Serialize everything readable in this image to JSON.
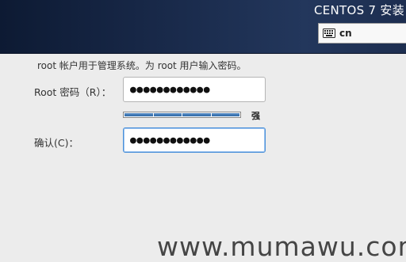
{
  "header": {
    "product_title": "CENTOS 7 安装",
    "keyboard_layout": "cn"
  },
  "form": {
    "instruction": "root 帐户用于管理系统。为 root 用户输入密码。",
    "root_label": "Root 密码（R）：",
    "root_value": "●●●●●●●●●●●●",
    "strength_label": "强",
    "strength_level": 1.0,
    "confirm_label": "确认(C)：",
    "confirm_value": "●●●●●●●●●●●●"
  },
  "watermark": "www.mumawu.com",
  "colors": {
    "header_bg": "#1a2b4c",
    "strength_fill": "#3a74b0",
    "focus_border": "#4a90d9"
  }
}
